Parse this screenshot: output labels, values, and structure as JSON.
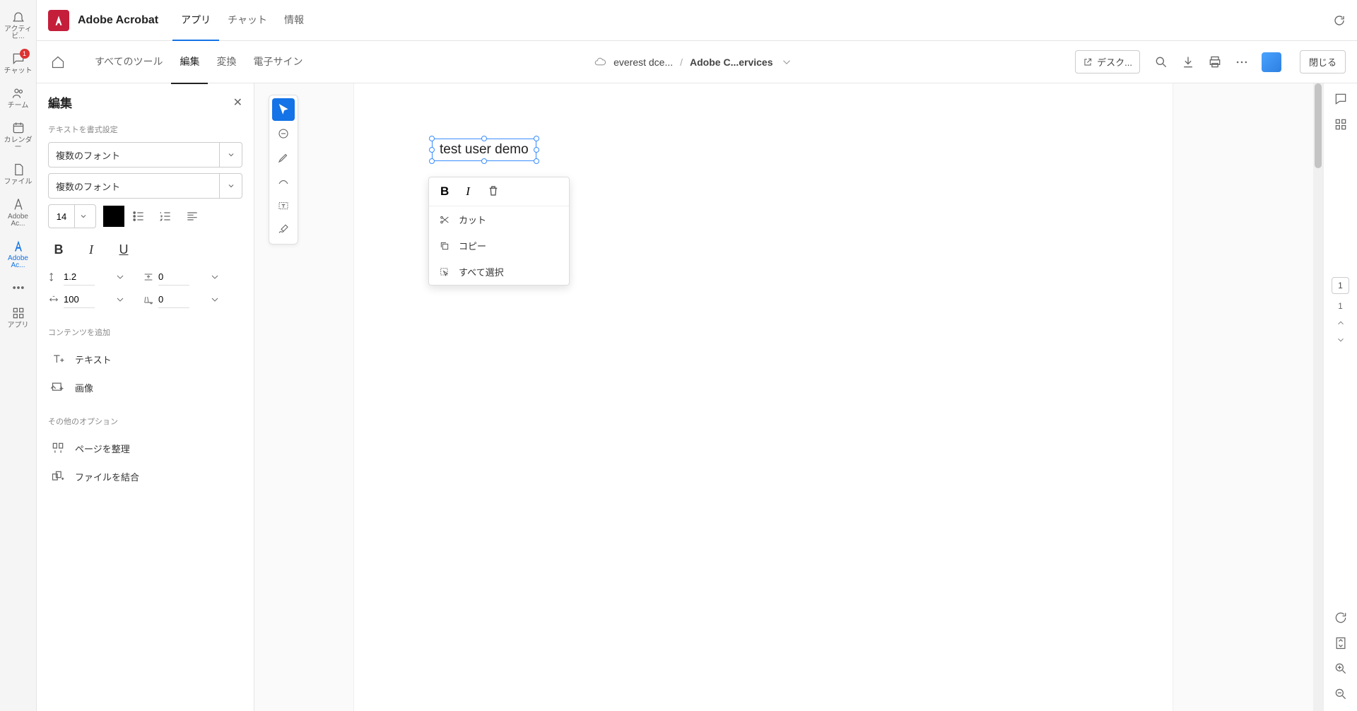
{
  "rail": {
    "activity": "アクティビ...",
    "chat": "チャット",
    "team": "チーム",
    "calendar": "カレンダー",
    "files": "ファイル",
    "acrobat": "Adobe Ac...",
    "acrobat2": "Adobe Ac...",
    "apps": "アプリ",
    "chat_badge": "1"
  },
  "header": {
    "app_title": "Adobe Acrobat",
    "tabs": [
      "アプリ",
      "チャット",
      "情報"
    ]
  },
  "secondary": {
    "tabs": [
      "すべてのツール",
      "編集",
      "変換",
      "電子サイン"
    ],
    "breadcrumb_cloud": "everest dce...",
    "breadcrumb_doc": "Adobe C...ervices",
    "desk_btn": "デスク...",
    "close_btn": "閉じる"
  },
  "edit_panel": {
    "title": "編集",
    "section_format": "テキストを書式設定",
    "font1": "複数のフォント",
    "font2": "複数のフォント",
    "font_size": "14",
    "line_height": "1.2",
    "letter_spacing": "0",
    "scale": "100",
    "baseline": "0",
    "section_content": "コンテンツを追加",
    "add_text": "テキスト",
    "add_image": "画像",
    "section_other": "その他のオプション",
    "organize": "ページを整理",
    "combine": "ファイルを結合"
  },
  "canvas": {
    "text_content": "test user demo"
  },
  "context_menu": {
    "cut": "カット",
    "copy": "コピー",
    "select_all": "すべて選択"
  },
  "right": {
    "current_page": "1",
    "total_pages": "1"
  }
}
